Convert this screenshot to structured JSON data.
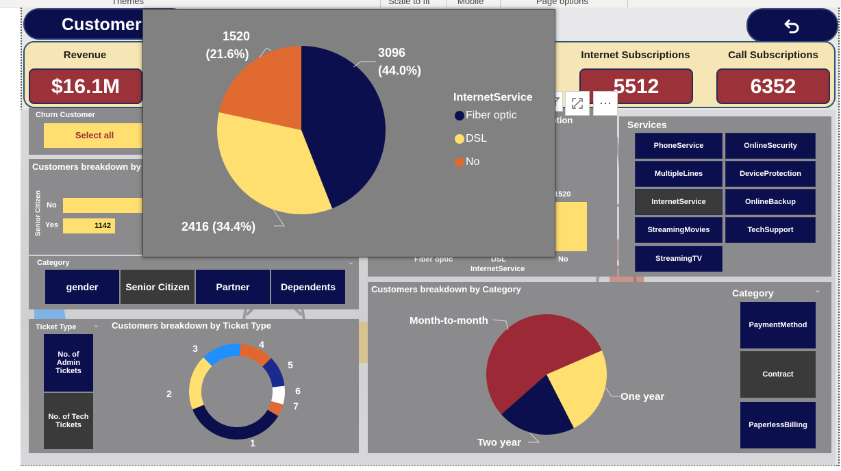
{
  "ribbon": {
    "themes": "Themes",
    "scale": "Scale to fit",
    "mobile": "Mobile",
    "page_options": "Page options"
  },
  "header": {
    "title": "Customer",
    "back_icon": "undo-arrow-icon"
  },
  "kpis": [
    {
      "label": "Revenue",
      "value": "$16.1M"
    },
    {
      "label": "Internet Subscriptions",
      "value": "5512"
    },
    {
      "label": "Call Subscriptions",
      "value": "6352"
    }
  ],
  "churn_slicer": {
    "title": "Churn Customer",
    "selected": "Select all"
  },
  "senior_chart": {
    "title": "Customers breakdown by",
    "axis_label": "Senior Citizen",
    "chart_data": {
      "type": "bar",
      "categories": [
        "No",
        "Yes"
      ],
      "values": [
        null,
        1142
      ],
      "data_labels": [
        "",
        "1142"
      ]
    }
  },
  "category_slicer": {
    "title": "Category",
    "buttons": [
      "gender",
      "Senior Citizen",
      "Partner",
      "Dependents"
    ]
  },
  "internet_bars": {
    "title": "iption",
    "axis_title": "InternetService",
    "data_label": "1520",
    "chart_data": {
      "type": "bar",
      "categories": [
        "Fiber optic",
        "DSL",
        "No"
      ],
      "values": [
        3096,
        2416,
        1520
      ]
    }
  },
  "services": {
    "title": "Services",
    "buttons": [
      "PhoneService",
      "OnlineSecurity",
      "MultipleLines",
      "DeviceProtection",
      "InternetService",
      "OnlineBackup",
      "StreamingMovies",
      "TechSupport",
      "StreamingTV"
    ],
    "selected": "InternetService"
  },
  "ticket_slicer": {
    "title": "Ticket Type",
    "buttons": [
      "No. of Admin Tickets",
      "No. of Tech Tickets"
    ]
  },
  "ticket_donut": {
    "title": "Customers breakdown by Ticket Type",
    "chart_data": {
      "type": "pie",
      "donut": true,
      "labels": [
        "1",
        "2",
        "3",
        "4",
        "5",
        "6",
        "7"
      ],
      "values": [
        34,
        18,
        13,
        11,
        10,
        6,
        4
      ],
      "colors": [
        "#0b0f4d",
        "#ffdf6f",
        "#1e90ff",
        "#e0672f",
        "#1a2a8f",
        "#ffffff",
        "#e06a3a"
      ]
    }
  },
  "category_pie": {
    "title": "Customers breakdown by Category",
    "chart_data": {
      "type": "pie",
      "labels": [
        "Month-to-month",
        "One year",
        "Two year"
      ],
      "values": [
        55,
        24,
        21
      ],
      "colors": [
        "#9c2a36",
        "#ffdf6f",
        "#0b0f4d"
      ]
    }
  },
  "category_slicer2": {
    "title": "Category",
    "buttons": [
      "PaymentMethod",
      "Contract",
      "PaperlessBilling"
    ],
    "selected": "Contract"
  },
  "popup": {
    "legend_title": "InternetService",
    "chart_data": {
      "type": "pie",
      "labels": [
        "Fiber optic",
        "DSL",
        "No"
      ],
      "values": [
        3096,
        2416,
        1520
      ],
      "percent_labels": [
        "(44.0%)",
        "(34.4%)",
        "(21.6%)"
      ],
      "colors": [
        "#0b0f4d",
        "#ffdf6f",
        "#e06a30"
      ]
    }
  }
}
